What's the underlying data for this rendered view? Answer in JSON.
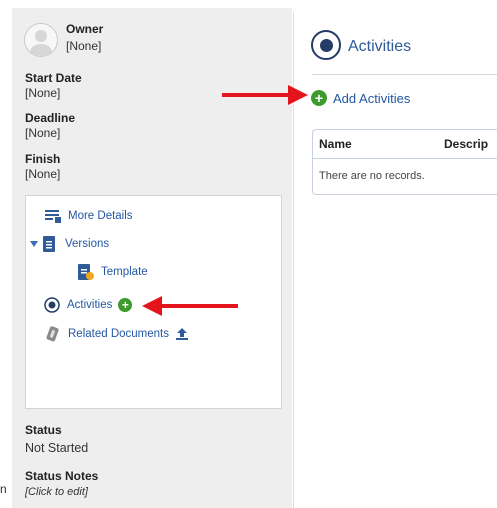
{
  "owner": {
    "label": "Owner",
    "value": "[None]"
  },
  "start_date": {
    "label": "Start Date",
    "value": "[None]"
  },
  "deadline": {
    "label": "Deadline",
    "value": "[None]"
  },
  "finish": {
    "label": "Finish",
    "value": "[None]"
  },
  "nav": {
    "more_details": "More Details",
    "versions": "Versions",
    "template": "Template",
    "activities": "Activities",
    "related_documents": "Related Documents"
  },
  "status": {
    "label": "Status",
    "value": "Not Started"
  },
  "status_notes": {
    "label": "Status Notes",
    "value": "[Click to edit]"
  },
  "activities_panel": {
    "title": "Activities",
    "add_label": "Add Activities",
    "columns": [
      "Name",
      "Descrip"
    ],
    "empty_text": "There are no records."
  },
  "stray_char": "n",
  "colors": {
    "accent_green": "#3d9b2e",
    "link_blue": "#2357a2",
    "annotation_red": "#e3141b",
    "panel_gray": "#eeeeee"
  },
  "icons": [
    "avatar-icon",
    "details-icon",
    "expand-triangle-icon",
    "document-icon",
    "template-icon",
    "radio-selected-icon",
    "add-icon",
    "paperclip-icon",
    "upload-icon",
    "arrow-annotation"
  ]
}
